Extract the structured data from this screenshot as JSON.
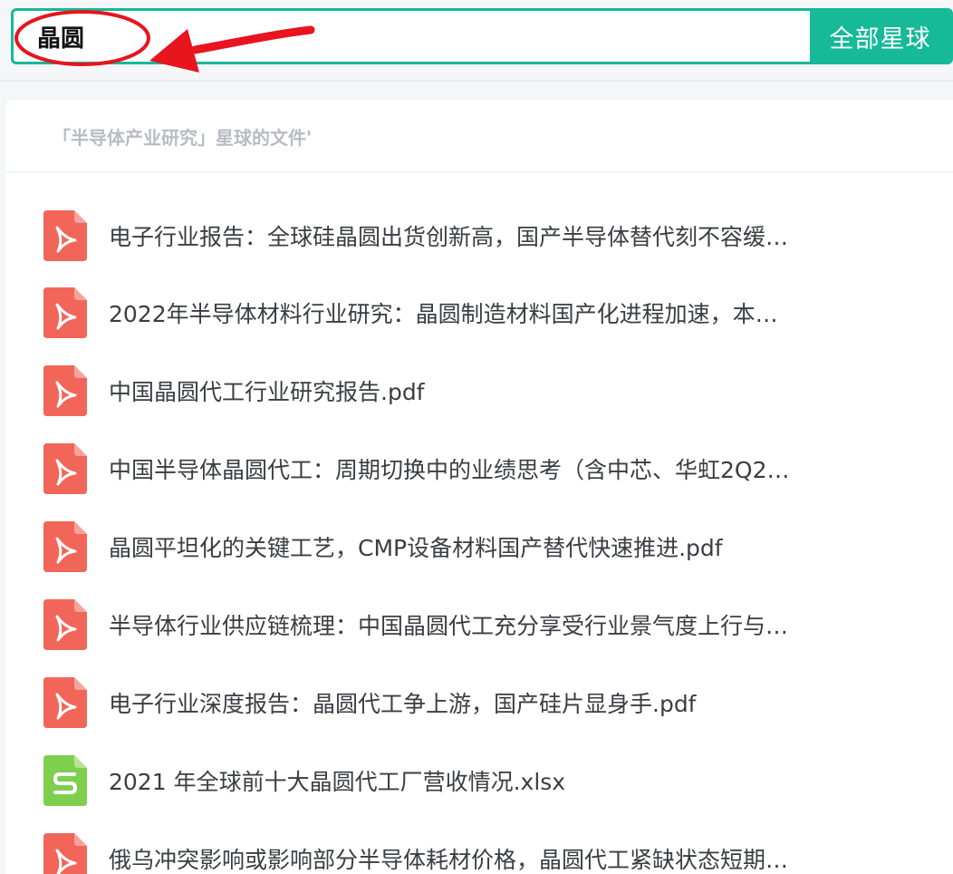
{
  "search": {
    "query": "晶圆",
    "scope_button": "全部星球"
  },
  "section": {
    "title": "「半导体产业研究」星球的文件'"
  },
  "colors": {
    "accent": "#16b998",
    "pdf_icon": "#f2665a",
    "xlsx_icon": "#7fcf4f",
    "annotation": "#e8141e"
  },
  "files": [
    {
      "name": "电子行业报告：全球硅晶圆出货创新高，国产半导体替代刻不容缓…",
      "icon": "pdf-file-icon"
    },
    {
      "name": "2022年半导体材料行业研究：晶圆制造材料国产化进程加速，本…",
      "icon": "pdf-file-icon"
    },
    {
      "name": "中国晶圆代工行业研究报告.pdf",
      "icon": "pdf-file-icon"
    },
    {
      "name": "中国半导体晶圆代工：周期切换中的业绩思考（含中芯、华虹2Q2…",
      "icon": "pdf-file-icon"
    },
    {
      "name": "晶圆平坦化的关键工艺，CMP设备材料国产替代快速推进.pdf",
      "icon": "pdf-file-icon"
    },
    {
      "name": "半导体行业供应链梳理：中国晶圆代工充分享受行业景气度上行与…",
      "icon": "pdf-file-icon"
    },
    {
      "name": "电子行业深度报告：晶圆代工争上游，国产硅片显身手.pdf",
      "icon": "pdf-file-icon"
    },
    {
      "name": "2021 年全球前十大晶圆代工厂营收情况.xlsx",
      "icon": "xlsx-file-icon"
    },
    {
      "name": "俄乌冲突影响或影响部分半导体耗材价格，晶圆代工紧缺状态短期…",
      "icon": "pdf-file-icon"
    }
  ]
}
